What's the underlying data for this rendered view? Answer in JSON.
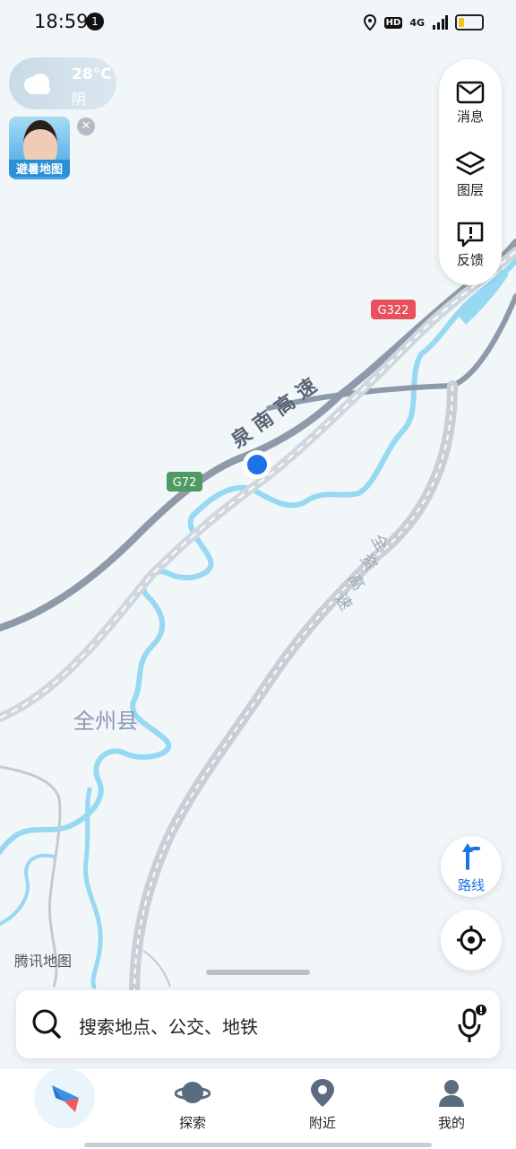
{
  "status_bar": {
    "time": "18:59",
    "notification_count": "1",
    "hd_label": "HD",
    "network_label": "4G",
    "battery_level": 0.25
  },
  "weather": {
    "temperature": "28°C",
    "condition": "阴"
  },
  "promo": {
    "label": "避暑地图"
  },
  "tools": {
    "messages": "消息",
    "layers": "图层",
    "feedback": "反馈"
  },
  "map": {
    "road_badges": {
      "g322": "G322",
      "g72": "G72"
    },
    "labels": {
      "quannan": [
        "泉",
        "南",
        "高",
        "速"
      ],
      "quanzi": [
        "全",
        "资",
        "高",
        "速"
      ],
      "county": "全州县"
    },
    "watermark": "腾讯地图"
  },
  "route_button": {
    "label": "路线"
  },
  "search": {
    "placeholder": "搜索地点、公交、地铁"
  },
  "nav": {
    "explore": "探索",
    "nearby": "附近",
    "mine": "我的"
  },
  "colors": {
    "accent": "#1a73e8",
    "water": "#97d8f2",
    "highway": "#8e9aaa",
    "badge_red": "#e8505b",
    "badge_green": "#4e9a62"
  }
}
